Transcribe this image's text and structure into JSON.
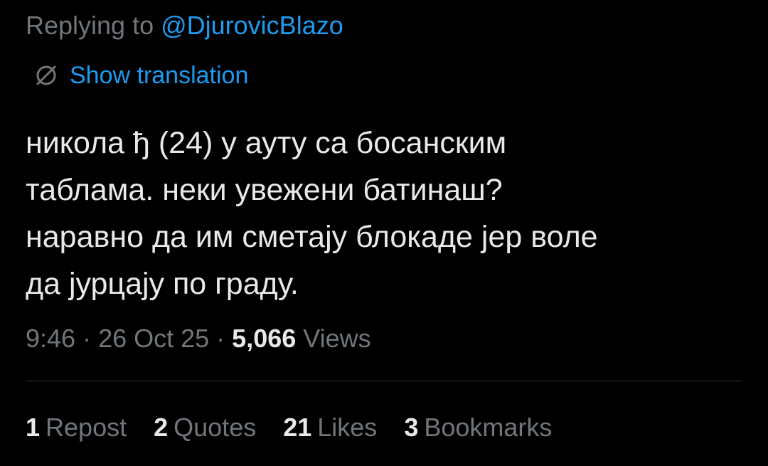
{
  "reply": {
    "prefix": "Replying to ",
    "handle": "@DjurovicBlazo"
  },
  "translation": {
    "icon": "globe-slash-icon",
    "label": "Show translation"
  },
  "tweet": {
    "lines": [
      "никола ђ (24) у ауту са босанским",
      "таблама. неки увежени батинаш?",
      "наравно да им сметају блокаде јер воле",
      "да јурцају по граду."
    ]
  },
  "meta": {
    "time": "9:46",
    "sep1": " · ",
    "date": "26 Oct 25",
    "sep2": " · ",
    "views_count": "5,066",
    "views_label": " Views"
  },
  "stats": [
    {
      "count": "1",
      "label": "Repost"
    },
    {
      "count": "2",
      "label": "Quotes"
    },
    {
      "count": "21",
      "label": "Likes"
    },
    {
      "count": "3",
      "label": "Bookmarks"
    }
  ],
  "colors": {
    "background": "#000000",
    "text": "#e7e9ea",
    "secondary": "#71767b",
    "accent": "#1d9bf0",
    "divider": "#2f3336"
  }
}
